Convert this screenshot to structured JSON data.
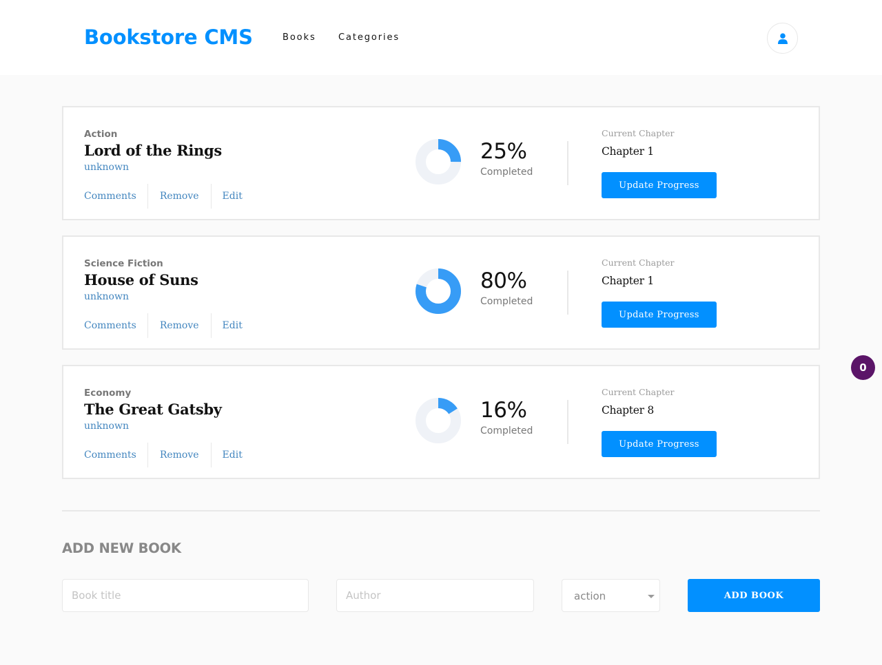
{
  "header": {
    "logo": "Bookstore CMS",
    "nav": [
      {
        "label": "Books"
      },
      {
        "label": "Categories"
      }
    ],
    "user_icon": "user-icon"
  },
  "books": [
    {
      "category": "Action",
      "title": "Lord of the Rings",
      "author": "unknown",
      "actions": [
        "Comments",
        "Remove",
        "Edit"
      ],
      "progress": 25,
      "percent_label": "25%",
      "completed_label": "Completed",
      "chapter_label": "Current Chapter",
      "chapter": "Chapter 1",
      "update_label": "Update Progress"
    },
    {
      "category": "Science Fiction",
      "title": "House of Suns",
      "author": "unknown",
      "actions": [
        "Comments",
        "Remove",
        "Edit"
      ],
      "progress": 80,
      "percent_label": "80%",
      "completed_label": "Completed",
      "chapter_label": "Current Chapter",
      "chapter": "Chapter 1",
      "update_label": "Update Progress"
    },
    {
      "category": "Economy",
      "title": "The Great Gatsby",
      "author": "unknown",
      "actions": [
        "Comments",
        "Remove",
        "Edit"
      ],
      "progress": 16,
      "percent_label": "16%",
      "completed_label": "Completed",
      "chapter_label": "Current Chapter",
      "chapter": "Chapter 8",
      "update_label": "Update Progress"
    }
  ],
  "floating_badge": "0",
  "add_form": {
    "title": "ADD NEW BOOK",
    "title_placeholder": "Book title",
    "author_placeholder": "Author",
    "category_value": "action",
    "submit_label": "ADD BOOK"
  },
  "colors": {
    "accent": "#0290ff",
    "progress_track": "#eff2f7",
    "progress_fill": "#379cf6",
    "badge": "#5b1568",
    "link": "#4386bf"
  }
}
